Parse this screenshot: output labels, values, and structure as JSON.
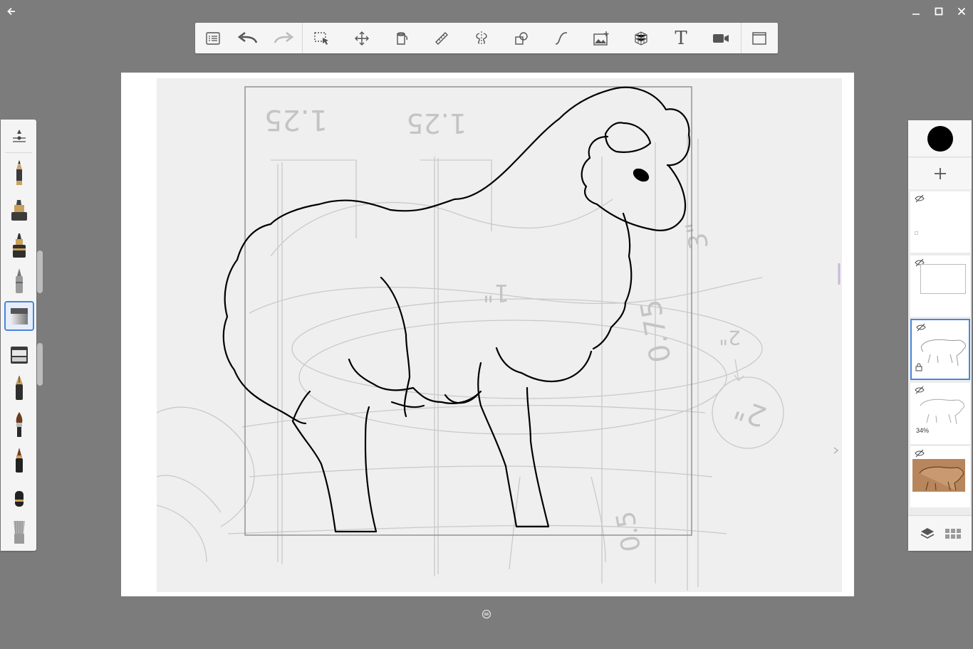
{
  "app": {
    "window_controls": [
      "back",
      "minimize",
      "maximize",
      "close"
    ]
  },
  "toolbar": {
    "tools": [
      {
        "id": "lists",
        "icon": "list-icon"
      },
      {
        "id": "undo",
        "icon": "undo-icon"
      },
      {
        "id": "redo",
        "icon": "redo-icon",
        "disabled": true
      },
      {
        "id": "selection",
        "icon": "selection-icon"
      },
      {
        "id": "transform",
        "icon": "move-icon"
      },
      {
        "id": "fill",
        "icon": "fill-icon"
      },
      {
        "id": "ruler",
        "icon": "ruler-icon"
      },
      {
        "id": "symmetry",
        "icon": "symmetry-icon"
      },
      {
        "id": "shapes",
        "icon": "shapes-icon"
      },
      {
        "id": "curves",
        "icon": "curve-icon"
      },
      {
        "id": "import-image",
        "icon": "add-image-icon"
      },
      {
        "id": "perspective",
        "icon": "perspective-grid-icon"
      },
      {
        "id": "text",
        "icon": "text-icon",
        "label": "T"
      },
      {
        "id": "time-lapse",
        "icon": "video-icon"
      },
      {
        "id": "fullscreen",
        "icon": "fullscreen-icon"
      }
    ]
  },
  "brushes": {
    "items": [
      "brush-settings",
      "pencil",
      "marker",
      "ink-pen",
      "ballpoint",
      "eraser",
      "soft-eraser",
      "fountain-pen",
      "paint-brush",
      "airbrush",
      "smudge",
      "blender"
    ],
    "selected": "eraser"
  },
  "canvas": {
    "sketch_labels": [
      "1.25",
      "1.25",
      "1\"",
      "0.75",
      "2\"",
      "0.5",
      "3\"",
      "2\""
    ]
  },
  "color": {
    "current": "#000000"
  },
  "layers": {
    "items": [
      {
        "name": "layer-5",
        "visible": true,
        "selected": false,
        "opacity_label": ""
      },
      {
        "name": "layer-4",
        "visible": true,
        "selected": false,
        "opacity_label": ""
      },
      {
        "name": "layer-3",
        "visible": true,
        "selected": true,
        "opacity_label": ""
      },
      {
        "name": "layer-2",
        "visible": true,
        "selected": false,
        "opacity_label": "34%"
      },
      {
        "name": "layer-1",
        "visible": true,
        "selected": false,
        "opacity_label": ""
      }
    ]
  }
}
